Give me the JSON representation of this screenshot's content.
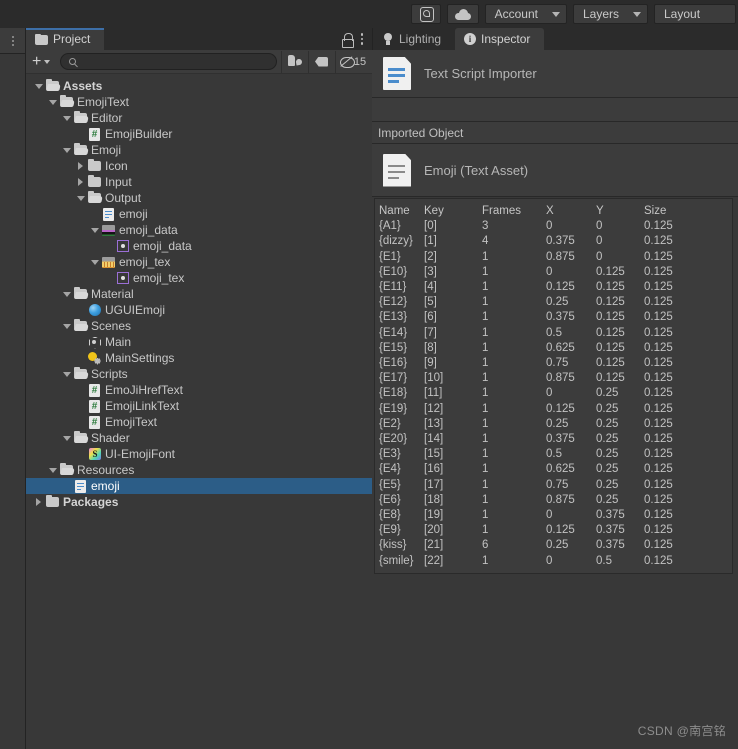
{
  "toolbar": {
    "collab_icon": "collab-icon",
    "cloud_icon": "cloud-icon",
    "account_label": "Account",
    "layers_label": "Layers",
    "layout_label": "Layout"
  },
  "project_panel": {
    "tab_label": "Project",
    "tab_icon": "folder-icon",
    "lock_icon": "lock-icon",
    "menu_icon": "kebab-menu-icon",
    "create_label": "+",
    "search_placeholder": "",
    "search_value": "",
    "search_icon": "search-icon",
    "paint_icon": "paint-icon",
    "tag_icon": "tag-icon",
    "hidden_icon": "eye-off-icon",
    "hidden_count": "15"
  },
  "tree": [
    {
      "label": "Assets",
      "depth": 0,
      "twisty": "down",
      "icon": "folder-open-icon",
      "bold": true,
      "selected": false
    },
    {
      "label": "EmojiText",
      "depth": 1,
      "twisty": "down",
      "icon": "folder-open-icon",
      "bold": false,
      "selected": false
    },
    {
      "label": "Editor",
      "depth": 2,
      "twisty": "down",
      "icon": "folder-open-icon",
      "bold": false,
      "selected": false
    },
    {
      "label": "EmojiBuilder",
      "depth": 3,
      "twisty": "none",
      "icon": "csharp-script-icon",
      "bold": false,
      "selected": false
    },
    {
      "label": "Emoji",
      "depth": 2,
      "twisty": "down",
      "icon": "folder-open-icon",
      "bold": false,
      "selected": false
    },
    {
      "label": "Icon",
      "depth": 3,
      "twisty": "right",
      "icon": "folder-closed-icon",
      "bold": false,
      "selected": false
    },
    {
      "label": "Input",
      "depth": 3,
      "twisty": "right",
      "icon": "folder-closed-icon",
      "bold": false,
      "selected": false
    },
    {
      "label": "Output",
      "depth": 3,
      "twisty": "down",
      "icon": "folder-open-icon",
      "bold": false,
      "selected": false
    },
    {
      "label": "emoji",
      "depth": 4,
      "twisty": "none",
      "icon": "text-asset-icon",
      "bold": false,
      "selected": false
    },
    {
      "label": "emoji_data",
      "depth": 4,
      "twisty": "down",
      "icon": "texture-data-icon",
      "bold": false,
      "selected": false
    },
    {
      "label": "emoji_data",
      "depth": 5,
      "twisty": "none",
      "icon": "sprite-icon",
      "bold": false,
      "selected": false
    },
    {
      "label": "emoji_tex",
      "depth": 4,
      "twisty": "down",
      "icon": "texture-tex-icon",
      "bold": false,
      "selected": false
    },
    {
      "label": "emoji_tex",
      "depth": 5,
      "twisty": "none",
      "icon": "sprite-icon",
      "bold": false,
      "selected": false
    },
    {
      "label": "Material",
      "depth": 2,
      "twisty": "down",
      "icon": "folder-open-icon",
      "bold": false,
      "selected": false
    },
    {
      "label": "UGUIEmoji",
      "depth": 3,
      "twisty": "none",
      "icon": "material-icon",
      "bold": false,
      "selected": false
    },
    {
      "label": "Scenes",
      "depth": 2,
      "twisty": "down",
      "icon": "folder-open-icon",
      "bold": false,
      "selected": false
    },
    {
      "label": "Main",
      "depth": 3,
      "twisty": "none",
      "icon": "scene-icon",
      "bold": false,
      "selected": false
    },
    {
      "label": "MainSettings",
      "depth": 3,
      "twisty": "none",
      "icon": "lighting-settings-icon",
      "bold": false,
      "selected": false
    },
    {
      "label": "Scripts",
      "depth": 2,
      "twisty": "down",
      "icon": "folder-open-icon",
      "bold": false,
      "selected": false
    },
    {
      "label": "EmoJiHrefText",
      "depth": 3,
      "twisty": "none",
      "icon": "csharp-script-icon",
      "bold": false,
      "selected": false
    },
    {
      "label": "EmojiLinkText",
      "depth": 3,
      "twisty": "none",
      "icon": "csharp-script-icon",
      "bold": false,
      "selected": false
    },
    {
      "label": "EmojiText",
      "depth": 3,
      "twisty": "none",
      "icon": "csharp-script-icon",
      "bold": false,
      "selected": false
    },
    {
      "label": "Shader",
      "depth": 2,
      "twisty": "down",
      "icon": "folder-open-icon",
      "bold": false,
      "selected": false
    },
    {
      "label": "UI-EmojiFont",
      "depth": 3,
      "twisty": "none",
      "icon": "shader-icon",
      "bold": false,
      "selected": false
    },
    {
      "label": "Resources",
      "depth": 1,
      "twisty": "down",
      "icon": "folder-open-icon",
      "bold": false,
      "selected": false
    },
    {
      "label": "emoji",
      "depth": 2,
      "twisty": "none",
      "icon": "text-asset-icon",
      "bold": false,
      "selected": true
    },
    {
      "label": "Packages",
      "depth": 0,
      "twisty": "right",
      "icon": "folder-closed-icon",
      "bold": true,
      "selected": false
    }
  ],
  "inspector": {
    "tabs": [
      {
        "label": "Lighting",
        "icon": "bulb-icon",
        "active": false
      },
      {
        "label": "Inspector",
        "icon": "info-icon",
        "active": true
      }
    ],
    "importer_title": "Text Script Importer",
    "importer_icon": "text-document-icon",
    "section_label": "Imported Object",
    "object_title": "Emoji (Text Asset)",
    "object_icon": "text-document-grey-icon"
  },
  "emoji_table": {
    "headers": [
      "Name",
      "Key",
      "Frames",
      "X",
      "Y",
      "Size"
    ],
    "rows": [
      [
        "{A1}",
        "[0]",
        "3",
        "0",
        "0",
        "0.125"
      ],
      [
        "{dizzy}",
        "[1]",
        "4",
        "0.375",
        "0",
        "0.125"
      ],
      [
        "{E1}",
        "[2]",
        "1",
        "0.875",
        "0",
        "0.125"
      ],
      [
        "{E10}",
        "[3]",
        "1",
        "0",
        "0.125",
        "0.125"
      ],
      [
        "{E11}",
        "[4]",
        "1",
        "0.125",
        "0.125",
        "0.125"
      ],
      [
        "{E12}",
        "[5]",
        "1",
        "0.25",
        "0.125",
        "0.125"
      ],
      [
        "{E13}",
        "[6]",
        "1",
        "0.375",
        "0.125",
        "0.125"
      ],
      [
        "{E14}",
        "[7]",
        "1",
        "0.5",
        "0.125",
        "0.125"
      ],
      [
        "{E15}",
        "[8]",
        "1",
        "0.625",
        "0.125",
        "0.125"
      ],
      [
        "{E16}",
        "[9]",
        "1",
        "0.75",
        "0.125",
        "0.125"
      ],
      [
        "{E17}",
        "[10]",
        "1",
        "0.875",
        "0.125",
        "0.125"
      ],
      [
        "{E18}",
        "[11]",
        "1",
        "0",
        "0.25",
        "0.125"
      ],
      [
        "{E19}",
        "[12]",
        "1",
        "0.125",
        "0.25",
        "0.125"
      ],
      [
        "{E2}",
        "[13]",
        "1",
        "0.25",
        "0.25",
        "0.125"
      ],
      [
        "{E20}",
        "[14]",
        "1",
        "0.375",
        "0.25",
        "0.125"
      ],
      [
        "{E3}",
        "[15]",
        "1",
        "0.5",
        "0.25",
        "0.125"
      ],
      [
        "{E4}",
        "[16]",
        "1",
        "0.625",
        "0.25",
        "0.125"
      ],
      [
        "{E5}",
        "[17]",
        "1",
        "0.75",
        "0.25",
        "0.125"
      ],
      [
        "{E6}",
        "[18]",
        "1",
        "0.875",
        "0.25",
        "0.125"
      ],
      [
        "{E8}",
        "[19]",
        "1",
        "0",
        "0.375",
        "0.125"
      ],
      [
        "{E9}",
        "[20]",
        "1",
        "0.125",
        "0.375",
        "0.125"
      ],
      [
        "{kiss}",
        "[21]",
        "6",
        "0.25",
        "0.375",
        "0.125"
      ],
      [
        "{smile}",
        "[22]",
        "1",
        "0",
        "0.5",
        "0.125"
      ]
    ]
  },
  "watermark": "CSDN @南宫铭",
  "colors": {
    "selection_blue": "#2c5d87",
    "panel_bg": "#383838",
    "header_bg": "#3c3c3c",
    "toolbar_bg": "#2b2b2b",
    "tab_accent": "#3d6fa8"
  }
}
